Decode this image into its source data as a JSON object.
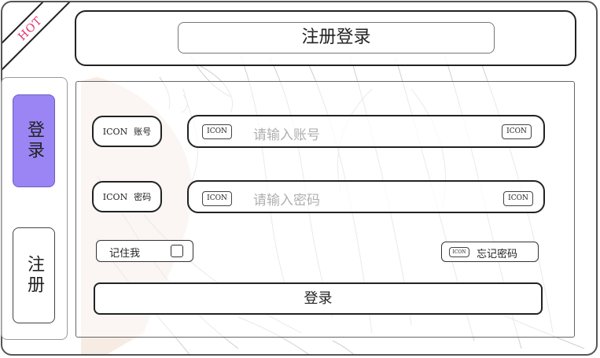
{
  "badge": {
    "text": "HOT"
  },
  "header": {
    "title": "注册登录"
  },
  "sidebar": {
    "tabs": [
      {
        "label": "登录",
        "active": true
      },
      {
        "label": "注册",
        "active": false
      }
    ]
  },
  "form": {
    "account": {
      "icon_text": "ICON",
      "label": "账号",
      "left_icon": "ICON",
      "placeholder": "请输入账号",
      "right_icon": "ICON"
    },
    "password": {
      "icon_text": "ICON",
      "label": "密码",
      "left_icon": "ICON",
      "placeholder": "请输入密码",
      "right_icon": "ICON"
    },
    "remember": {
      "label": "记住我",
      "checked": false
    },
    "forgot": {
      "icon_text": "ICON",
      "label": "忘记密码"
    },
    "submit": {
      "label": "登录"
    }
  },
  "colors": {
    "active_tab": "#9b85f5",
    "badge_text": "#e0306a"
  }
}
